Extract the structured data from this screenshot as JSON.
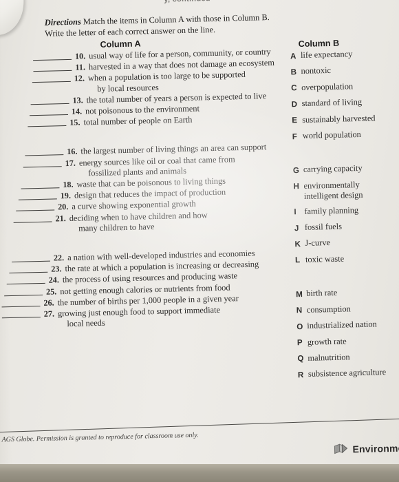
{
  "page": {
    "running_head": "y, continued",
    "directions_lead": "Directions",
    "directions_text": "Match the items in Column A with those in Column B. Write the letter of each correct answer on the line.",
    "column_a_heading": "Column A",
    "column_b_heading": "Column B"
  },
  "column_a": [
    {
      "number": "10.",
      "text": "usual way of life for a person, community, or country",
      "cont": ""
    },
    {
      "number": "11.",
      "text": "harvested in a way that does not damage an ecosystem",
      "cont": ""
    },
    {
      "number": "12.",
      "text": "when a population is too large to be supported",
      "cont": "by local resources"
    },
    {
      "number": "13.",
      "text": "the total number of years a person is expected to live",
      "cont": ""
    },
    {
      "number": "14.",
      "text": "not poisonous to the environment",
      "cont": ""
    },
    {
      "number": "15.",
      "text": "total number of people on Earth",
      "cont": ""
    },
    {
      "number": "16.",
      "text": "the largest number of living things an area can support",
      "cont": ""
    },
    {
      "number": "17.",
      "text": "energy sources like oil or coal that came from",
      "cont": "fossilized plants and animals"
    },
    {
      "number": "18.",
      "text": "waste that can be poisonous to living things",
      "cont": ""
    },
    {
      "number": "19.",
      "text": "design that reduces the impact of production",
      "cont": ""
    },
    {
      "number": "20.",
      "text": "a curve showing exponential growth",
      "cont": ""
    },
    {
      "number": "21.",
      "text": "deciding when to have children and how",
      "cont": "many children to have"
    },
    {
      "number": "22.",
      "text": "a nation with well-developed industries and economies",
      "cont": ""
    },
    {
      "number": "23.",
      "text": "the rate at which a population is increasing or decreasing",
      "cont": ""
    },
    {
      "number": "24.",
      "text": "the process of using resources and producing waste",
      "cont": ""
    },
    {
      "number": "25.",
      "text": "not getting enough calories or nutrients from food",
      "cont": ""
    },
    {
      "number": "26.",
      "text": "the number of births per 1,000 people in a given year",
      "cont": ""
    },
    {
      "number": "27.",
      "text": "growing just enough food to support immediate",
      "cont": "local needs"
    }
  ],
  "column_b": [
    {
      "letter": "A",
      "text": "life expectancy",
      "cont": ""
    },
    {
      "letter": "B",
      "text": "nontoxic",
      "cont": ""
    },
    {
      "letter": "C",
      "text": "overpopulation",
      "cont": ""
    },
    {
      "letter": "D",
      "text": "standard of living",
      "cont": ""
    },
    {
      "letter": "E",
      "text": "sustainably harvested",
      "cont": ""
    },
    {
      "letter": "F",
      "text": "world population",
      "cont": ""
    },
    {
      "letter": "G",
      "text": "carrying capacity",
      "cont": ""
    },
    {
      "letter": "H",
      "text": "environmentally",
      "cont": "intelligent design"
    },
    {
      "letter": "I",
      "text": "family planning",
      "cont": ""
    },
    {
      "letter": "J",
      "text": "fossil fuels",
      "cont": ""
    },
    {
      "letter": "K",
      "text": "J-curve",
      "cont": ""
    },
    {
      "letter": "L",
      "text": "toxic waste",
      "cont": ""
    },
    {
      "letter": "M",
      "text": "birth rate",
      "cont": ""
    },
    {
      "letter": "N",
      "text": "consumption",
      "cont": ""
    },
    {
      "letter": "O",
      "text": "industrialized nation",
      "cont": ""
    },
    {
      "letter": "P",
      "text": "growth rate",
      "cont": ""
    },
    {
      "letter": "Q",
      "text": "malnutrition",
      "cont": ""
    },
    {
      "letter": "R",
      "text": "subsistence agriculture",
      "cont": ""
    }
  ],
  "footer": {
    "copyright": "earson AGS Globe. Permission is granted to reproduce for classroom use only.",
    "brand_label": "Environmenta",
    "brand_icon": "book-cube-arrow-icon"
  },
  "colors": {
    "paper": "#eceae5",
    "ink": "#2e2d2c",
    "desk_wood": "#8a6a42",
    "rule": "#4b4a47"
  }
}
